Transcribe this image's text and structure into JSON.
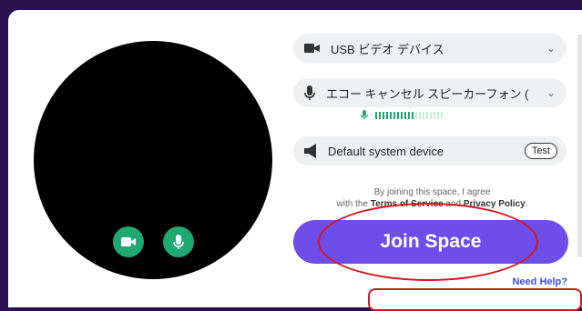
{
  "devices": {
    "camera": {
      "label": "USB ビデオ デバイス",
      "icon": "video-camera-icon"
    },
    "microphone": {
      "label": "エコー キャンセル スピーカーフォン (",
      "icon": "microphone-icon"
    },
    "speaker": {
      "label": "Default system device",
      "icon": "speaker-icon",
      "test_label": "Test"
    }
  },
  "mic_level": {
    "active_bars": 11,
    "total_bars": 19
  },
  "agreement": {
    "line1": "By joining this space, I agree",
    "line2_prefix": "with the ",
    "terms": "Terms of Service",
    "and": " and ",
    "privacy": "Privacy Policy",
    "suffix": "."
  },
  "join_label": "Join Space",
  "help_label": "Need Help?",
  "colors": {
    "accent": "#6d4ee8",
    "toggle_green": "#1fa870",
    "meter_active": "#1fa870",
    "meter_inactive": "#c9ecd9",
    "annotation_red": "#d4141c",
    "background": "#2a1150"
  }
}
